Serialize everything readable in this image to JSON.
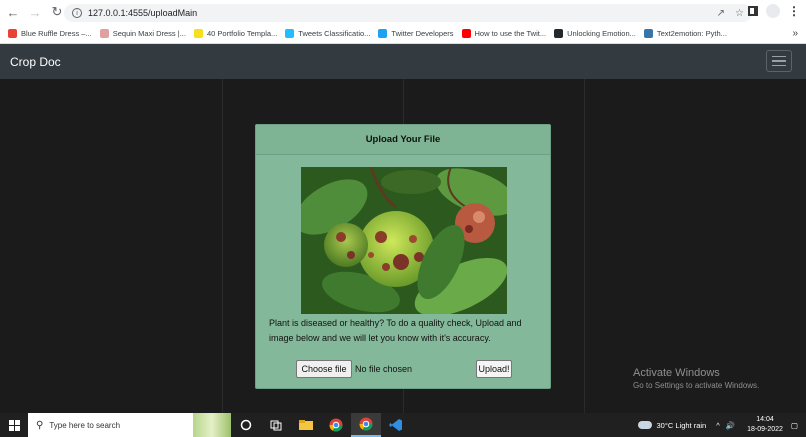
{
  "browser": {
    "url": "127.0.0.1:4555/uploadMain",
    "bookmarks": [
      {
        "label": "Blue Ruffle Dress –...",
        "icon": "gmail-icon",
        "color": "#ea4335"
      },
      {
        "label": "Sequin Maxi Dress |...",
        "icon": "site-icon",
        "color": "#e0a0a0"
      },
      {
        "label": "40 Portfolio Templa...",
        "icon": "js-icon",
        "color": "#f7df1e"
      },
      {
        "label": "Tweets Classificatio...",
        "icon": "kaggle-icon",
        "color": "#20beff"
      },
      {
        "label": "Twitter Developers",
        "icon": "twitter-icon",
        "color": "#1da1f2"
      },
      {
        "label": "How to use the Twit...",
        "icon": "youtube-icon",
        "color": "#ff0000"
      },
      {
        "label": "Unlocking Emotion...",
        "icon": "github-icon",
        "color": "#24292e"
      },
      {
        "label": "Text2emotion: Pyth...",
        "icon": "pypi-icon",
        "color": "#3775a9"
      }
    ]
  },
  "navbar": {
    "brand": "Crop Doc"
  },
  "card": {
    "title": "Upload Your File",
    "description": "Plant is diseased or healthy? To do a quality check, Upload and image below and we will let you know with it's accuracy.",
    "choose_file_label": "Choose file",
    "no_file_text": "No file chosen",
    "upload_label": "Upload!"
  },
  "watermark": {
    "line1": "Activate Windows",
    "line2": "Go to Settings to activate Windows."
  },
  "taskbar": {
    "search_placeholder": "Type here to search",
    "weather": "30°C  Light rain",
    "time": "14:04",
    "date": "18-09-2022"
  }
}
